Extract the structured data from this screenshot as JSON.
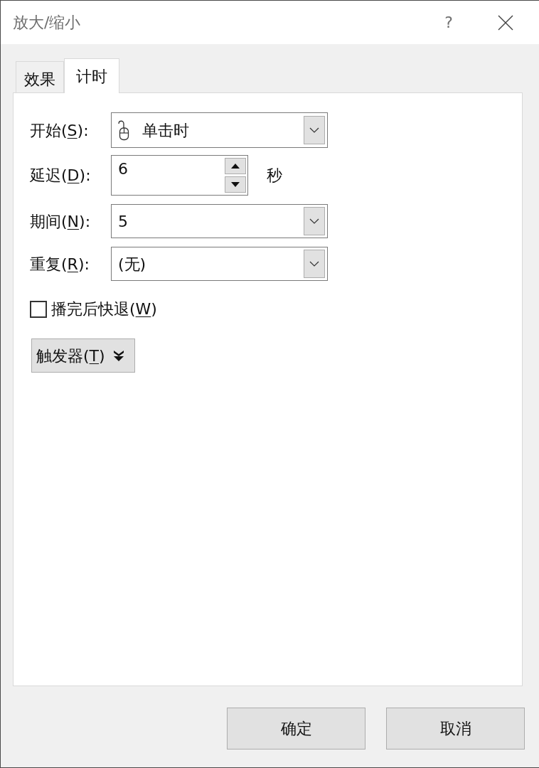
{
  "window": {
    "title": "放大/缩小",
    "help_button": "?"
  },
  "tabs": [
    {
      "label": "效果",
      "selected": false
    },
    {
      "label": "计时",
      "selected": true
    }
  ],
  "fields": [
    {
      "kind": "icon_dropdown",
      "label": {
        "before": "开始(",
        "access_key": "S",
        "after": "):"
      },
      "value": "单击时"
    },
    {
      "kind": "spinner",
      "label": {
        "before": "延迟(",
        "access_key": "D",
        "after": "):"
      },
      "value": "6",
      "unit": "秒"
    },
    {
      "kind": "dropdown",
      "label": {
        "before": "期间(",
        "access_key": "N",
        "after": "):"
      },
      "value": "5"
    },
    {
      "kind": "dropdown",
      "label": {
        "before": "重复(",
        "access_key": "R",
        "after": "):"
      },
      "value": "(无)"
    }
  ],
  "rewind_checkbox": {
    "label": {
      "before": "播完后快退(",
      "access_key": "W",
      "after": ")"
    },
    "checked": false
  },
  "triggers_button": {
    "label": {
      "before": "触发器(",
      "access_key": "T",
      "after": ")"
    },
    "expanded": false
  },
  "buttons": [
    {
      "label": "确定"
    },
    {
      "label": "取消"
    }
  ]
}
